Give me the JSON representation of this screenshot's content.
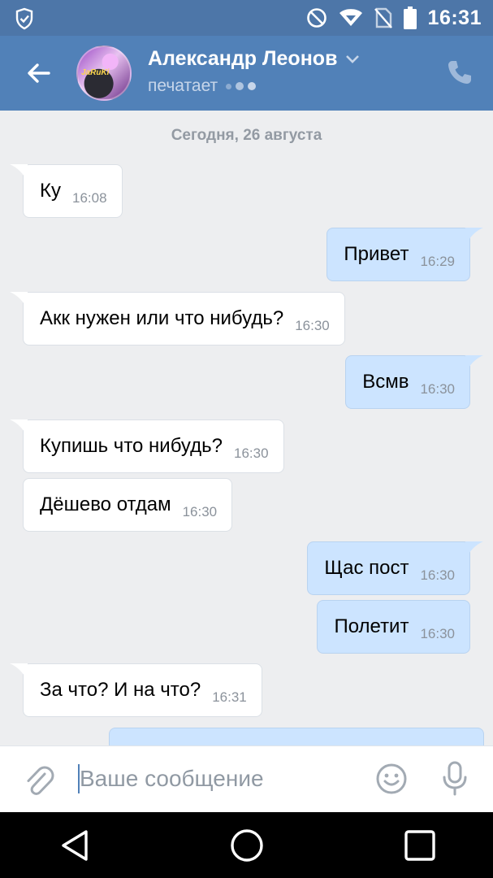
{
  "status_bar": {
    "time": "16:31",
    "icons": [
      "shield-check-icon",
      "do-not-disturb-icon",
      "wifi-icon",
      "no-sim-icon",
      "battery-icon"
    ]
  },
  "header": {
    "contact_name": "Александр Леонов",
    "contact_status": "печатает",
    "avatar_tag": "JaRuKi",
    "accent_color": "#5181b8"
  },
  "chat": {
    "date_separator": "Сегодня, 26 августа",
    "messages": [
      {
        "direction": "in",
        "text": "Ку",
        "time": "16:08"
      },
      {
        "direction": "out",
        "text": "Привет",
        "time": "16:29"
      },
      {
        "direction": "in",
        "text": "Акк нужен или что нибудь?",
        "time": "16:30"
      },
      {
        "direction": "out",
        "text": "Всмв",
        "time": "16:30"
      },
      {
        "direction": "in",
        "text": "Купишь что нибудь?",
        "time": "16:30"
      },
      {
        "direction": "in",
        "text": "Дёшево отдам",
        "time": "16:30"
      },
      {
        "direction": "out",
        "text": "Щас пост",
        "time": "16:30"
      },
      {
        "direction": "out",
        "text": "Полетит",
        "time": "16:30"
      },
      {
        "direction": "in",
        "text": "За что? И на что?",
        "time": "16:31"
      }
    ]
  },
  "composer": {
    "placeholder": "Ваше сообщение"
  },
  "nav_bar": {
    "buttons": [
      "back-triangle-icon",
      "home-circle-icon",
      "recents-square-icon"
    ]
  }
}
